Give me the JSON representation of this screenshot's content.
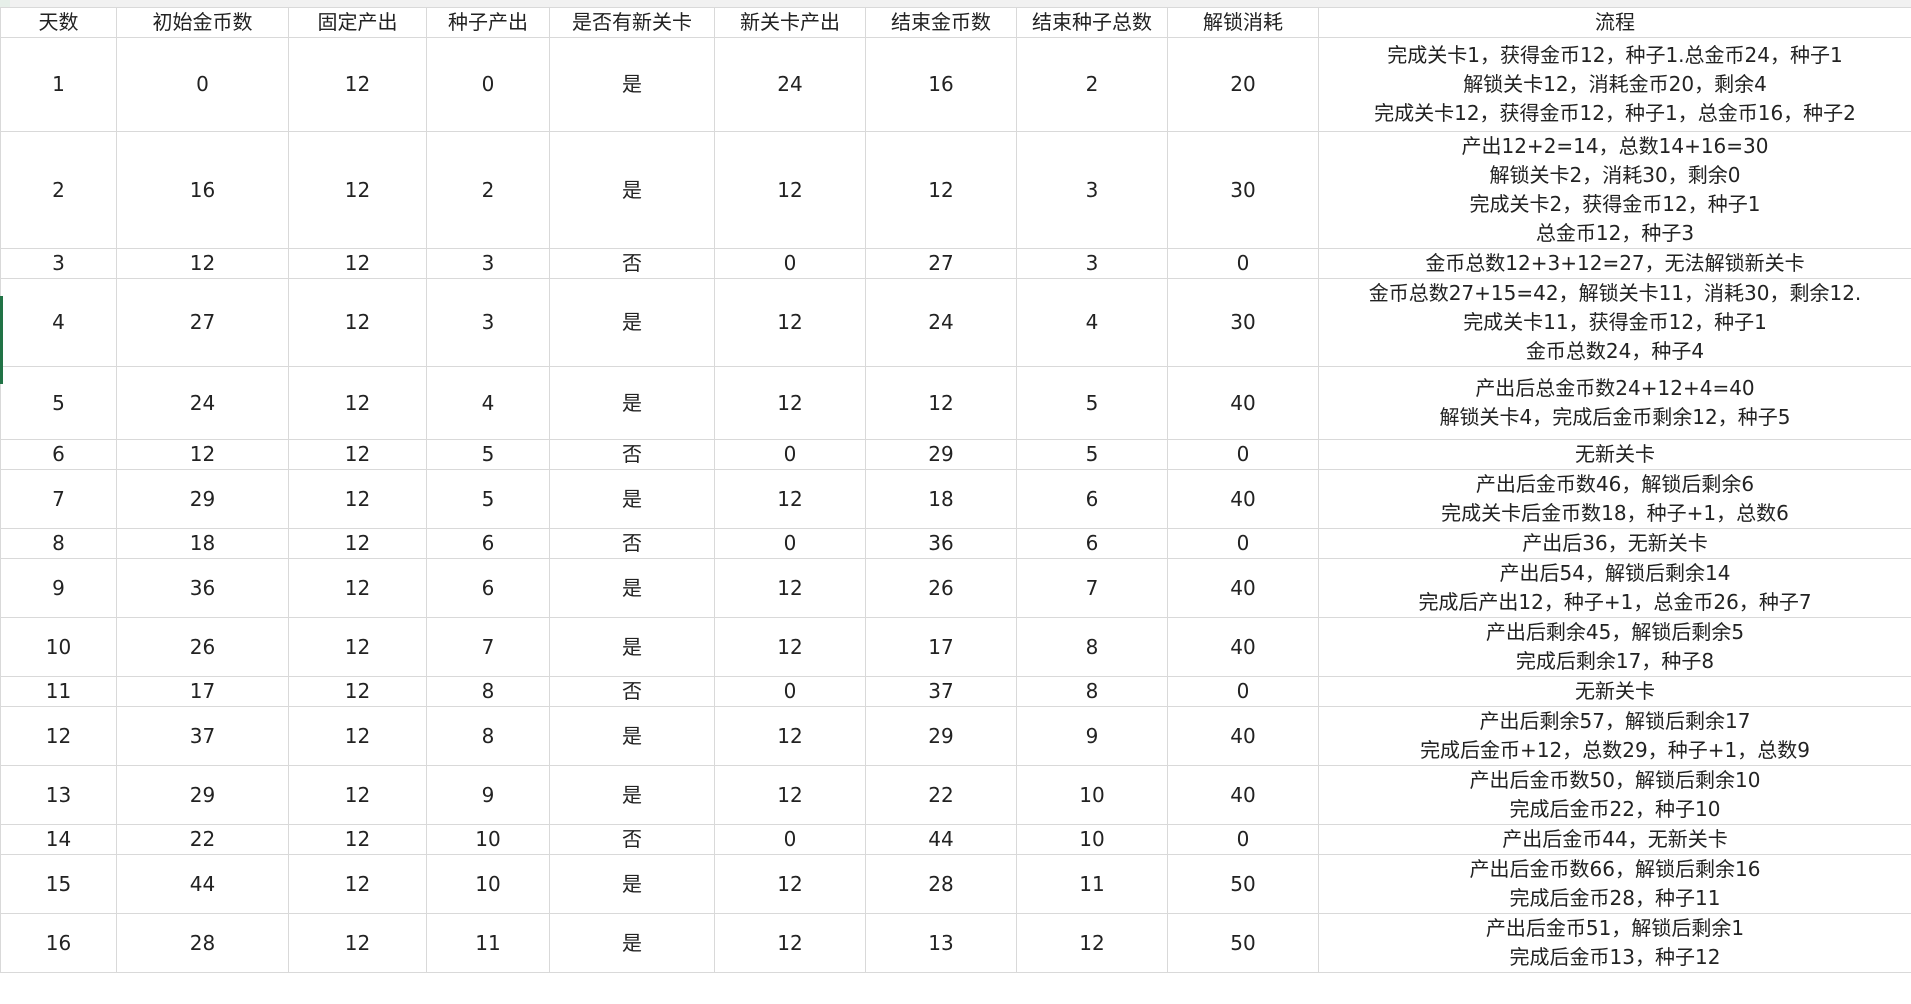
{
  "headers": [
    "天数",
    "初始金币数",
    "固定产出",
    "种子产出",
    "是否有新关卡",
    "新关卡产出",
    "结束金币数",
    "结束种子总数",
    "解锁消耗",
    "流程"
  ],
  "rows": [
    {
      "day": "1",
      "start_gold": "0",
      "fixed_output": "12",
      "seed_output": "0",
      "has_new_level": "是",
      "new_level_output": "24",
      "end_gold": "16",
      "end_seed_total": "2",
      "unlock_cost": "20",
      "flow": [
        "完成关卡1，获得金币12，种子1.总金币24，种子1",
        "解锁关卡12，消耗金币20，剩余4",
        "完成关卡12，获得金币12，种子1，总金币16，种子2"
      ]
    },
    {
      "day": "2",
      "start_gold": "16",
      "fixed_output": "12",
      "seed_output": "2",
      "has_new_level": "是",
      "new_level_output": "12",
      "end_gold": "12",
      "end_seed_total": "3",
      "unlock_cost": "30",
      "flow": [
        "产出12+2=14，总数14+16=30",
        "解锁关卡2，消耗30，剩余0",
        "完成关卡2，获得金币12，种子1",
        "总金币12，种子3"
      ]
    },
    {
      "day": "3",
      "start_gold": "12",
      "fixed_output": "12",
      "seed_output": "3",
      "has_new_level": "否",
      "new_level_output": "0",
      "end_gold": "27",
      "end_seed_total": "3",
      "unlock_cost": "0",
      "flow": [
        "金币总数12+3+12=27，无法解锁新关卡"
      ]
    },
    {
      "day": "4",
      "start_gold": "27",
      "fixed_output": "12",
      "seed_output": "3",
      "has_new_level": "是",
      "new_level_output": "12",
      "end_gold": "24",
      "end_seed_total": "4",
      "unlock_cost": "30",
      "flow": [
        "金币总数27+15=42，解锁关卡11，消耗30，剩余12.",
        "完成关卡11，获得金币12，种子1",
        "金币总数24，种子4"
      ]
    },
    {
      "day": "5",
      "start_gold": "24",
      "fixed_output": "12",
      "seed_output": "4",
      "has_new_level": "是",
      "new_level_output": "12",
      "end_gold": "12",
      "end_seed_total": "5",
      "unlock_cost": "40",
      "flow": [
        "产出后总金币数24+12+4=40",
        "解锁关卡4，完成后金币剩余12，种子5"
      ]
    },
    {
      "day": "6",
      "start_gold": "12",
      "fixed_output": "12",
      "seed_output": "5",
      "has_new_level": "否",
      "new_level_output": "0",
      "end_gold": "29",
      "end_seed_total": "5",
      "unlock_cost": "0",
      "flow": [
        "无新关卡"
      ]
    },
    {
      "day": "7",
      "start_gold": "29",
      "fixed_output": "12",
      "seed_output": "5",
      "has_new_level": "是",
      "new_level_output": "12",
      "end_gold": "18",
      "end_seed_total": "6",
      "unlock_cost": "40",
      "flow": [
        "产出后金币数46，解锁后剩余6",
        "完成关卡后金币数18，种子+1，总数6"
      ]
    },
    {
      "day": "8",
      "start_gold": "18",
      "fixed_output": "12",
      "seed_output": "6",
      "has_new_level": "否",
      "new_level_output": "0",
      "end_gold": "36",
      "end_seed_total": "6",
      "unlock_cost": "0",
      "flow": [
        "产出后36，无新关卡"
      ]
    },
    {
      "day": "9",
      "start_gold": "36",
      "fixed_output": "12",
      "seed_output": "6",
      "has_new_level": "是",
      "new_level_output": "12",
      "end_gold": "26",
      "end_seed_total": "7",
      "unlock_cost": "40",
      "flow": [
        "产出后54，解锁后剩余14",
        "完成后产出12，种子+1，总金币26，种子7"
      ]
    },
    {
      "day": "10",
      "start_gold": "26",
      "fixed_output": "12",
      "seed_output": "7",
      "has_new_level": "是",
      "new_level_output": "12",
      "end_gold": "17",
      "end_seed_total": "8",
      "unlock_cost": "40",
      "flow": [
        "产出后剩余45，解锁后剩余5",
        "完成后剩余17，种子8"
      ]
    },
    {
      "day": "11",
      "start_gold": "17",
      "fixed_output": "12",
      "seed_output": "8",
      "has_new_level": "否",
      "new_level_output": "0",
      "end_gold": "37",
      "end_seed_total": "8",
      "unlock_cost": "0",
      "flow": [
        "无新关卡"
      ]
    },
    {
      "day": "12",
      "start_gold": "37",
      "fixed_output": "12",
      "seed_output": "8",
      "has_new_level": "是",
      "new_level_output": "12",
      "end_gold": "29",
      "end_seed_total": "9",
      "unlock_cost": "40",
      "flow": [
        "产出后剩余57，解锁后剩余17",
        "完成后金币+12，总数29，种子+1，总数9"
      ]
    },
    {
      "day": "13",
      "start_gold": "29",
      "fixed_output": "12",
      "seed_output": "9",
      "has_new_level": "是",
      "new_level_output": "12",
      "end_gold": "22",
      "end_seed_total": "10",
      "unlock_cost": "40",
      "flow": [
        "产出后金币数50，解锁后剩余10",
        "完成后金币22，种子10"
      ]
    },
    {
      "day": "14",
      "start_gold": "22",
      "fixed_output": "12",
      "seed_output": "10",
      "has_new_level": "否",
      "new_level_output": "0",
      "end_gold": "44",
      "end_seed_total": "10",
      "unlock_cost": "0",
      "flow": [
        "产出后金币44，无新关卡"
      ]
    },
    {
      "day": "15",
      "start_gold": "44",
      "fixed_output": "12",
      "seed_output": "10",
      "has_new_level": "是",
      "new_level_output": "12",
      "end_gold": "28",
      "end_seed_total": "11",
      "unlock_cost": "50",
      "flow": [
        "产出后金币数66，解锁后剩余16",
        "完成后金币28，种子11"
      ]
    },
    {
      "day": "16",
      "start_gold": "28",
      "fixed_output": "12",
      "seed_output": "11",
      "has_new_level": "是",
      "new_level_output": "12",
      "end_gold": "13",
      "end_seed_total": "12",
      "unlock_cost": "50",
      "flow": [
        "产出后金币51，解锁后剩余1",
        "完成后金币13，种子12"
      ]
    }
  ]
}
